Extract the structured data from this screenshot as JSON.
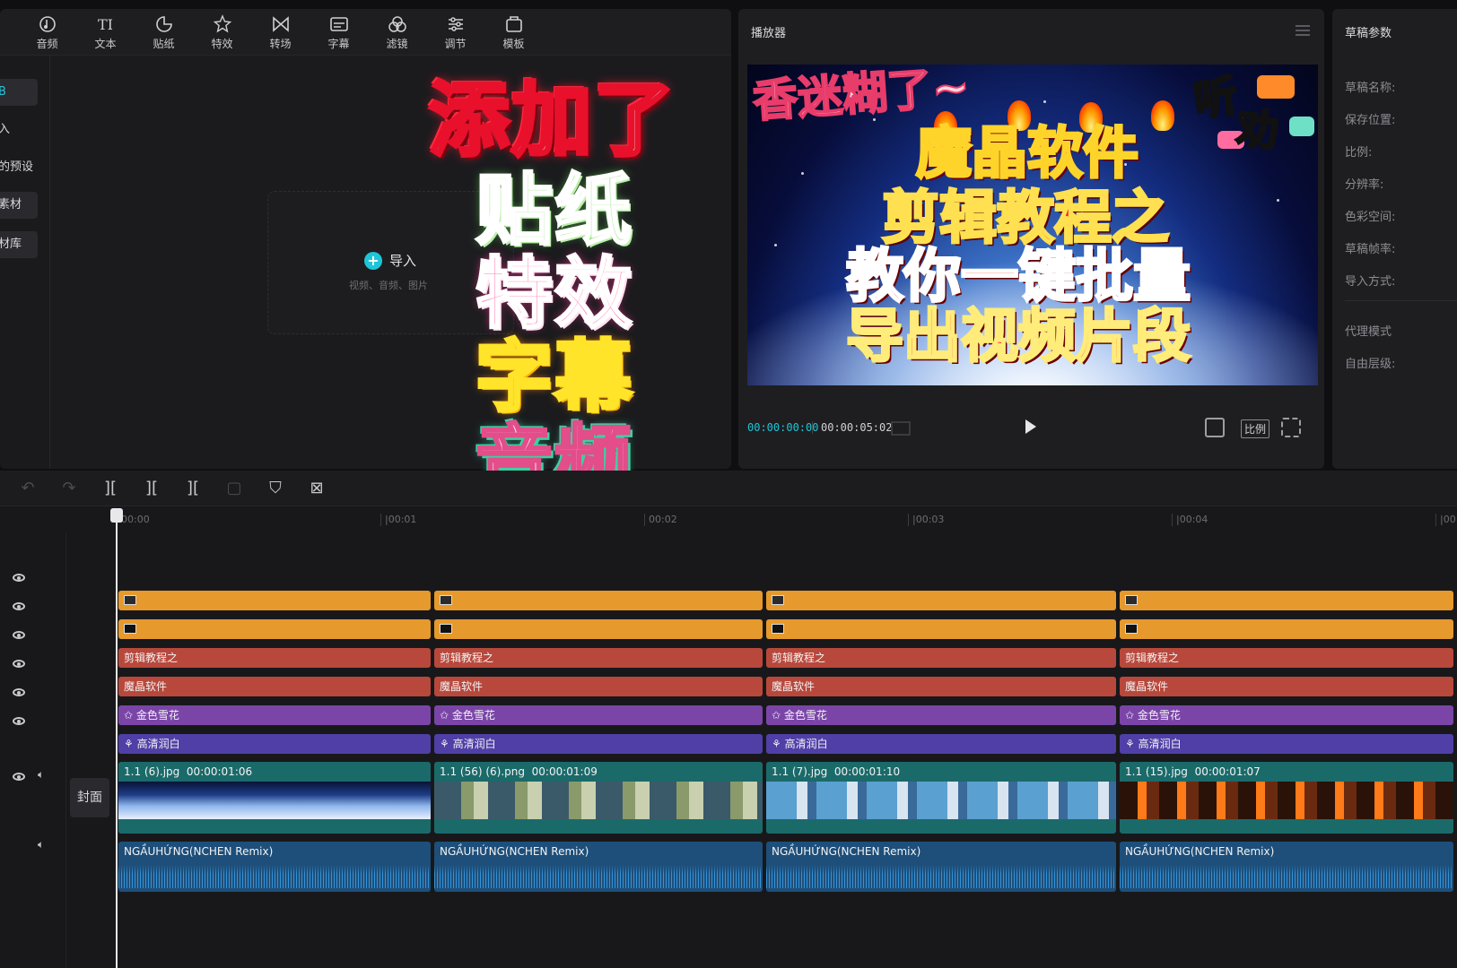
{
  "toolbar": {
    "items": [
      {
        "label": "音频",
        "icon": "music-icon"
      },
      {
        "label": "文本",
        "icon": "text-icon"
      },
      {
        "label": "贴纸",
        "icon": "sticker-icon"
      },
      {
        "label": "特效",
        "icon": "effects-icon"
      },
      {
        "label": "转场",
        "icon": "transition-icon"
      },
      {
        "label": "字幕",
        "icon": "subtitle-icon"
      },
      {
        "label": "滤镜",
        "icon": "filter-icon"
      },
      {
        "label": "调节",
        "icon": "adjust-icon"
      },
      {
        "label": "模板",
        "icon": "template-icon"
      }
    ]
  },
  "sidebar": {
    "items": [
      {
        "label": "B"
      },
      {
        "label": "入"
      },
      {
        "label": "的预设"
      },
      {
        "label": "素材"
      },
      {
        "label": "材库"
      }
    ]
  },
  "media": {
    "import_label": "导入",
    "import_hint": "视频、音频、图片"
  },
  "overlay": {
    "line1": "添加了",
    "line2": "贴纸",
    "line3": "特效",
    "line4": "字幕",
    "line5": "音频"
  },
  "player": {
    "title": "播放器",
    "screen": {
      "text0": "香迷糊了~",
      "text1": "魔晶软件",
      "text2": "剪辑教程之",
      "text3": "教你一键批量",
      "text4": "导出视频片段",
      "text5": "听",
      "text6": "劝"
    },
    "current_time": "00:00:00:00",
    "total_time": "00:00:05:02",
    "ratio_label": "比例"
  },
  "draft": {
    "title": "草稿参数",
    "fields": [
      "草稿名称:",
      "保存位置:",
      "比例:",
      "分辨率:",
      "色彩空间:",
      "草稿帧率:",
      "导入方式:"
    ],
    "fields2": [
      "代理模式",
      "自由层级:"
    ]
  },
  "timeline": {
    "ruler": [
      "00:00",
      "|00:01",
      "00:02",
      "|00:03",
      "|00:04",
      "|00:0"
    ],
    "cover_label": "封面",
    "text_clip_a": "剪辑教程之",
    "text_clip_b": "魔晶软件",
    "effect_clip": "金色雪花",
    "filter_clip": "高清润白",
    "video_clips": [
      {
        "name": "1.1 (6).jpg",
        "duration": "00:00:01:06"
      },
      {
        "name": "1.1 (56) (6).png",
        "duration": "00:00:01:09"
      },
      {
        "name": "1.1 (7).jpg",
        "duration": "00:00:01:10"
      },
      {
        "name": "1.1 (15).jpg",
        "duration": "00:00:01:07"
      }
    ],
    "audio_clip": "NGẦUHỨNG(NCHEN Remix)"
  },
  "colors": {
    "accent": "#1fc4d6",
    "sticker_track": "#e6992c",
    "text_track": "#b8483b",
    "effect_track": "#7b45a8",
    "filter_track": "#4f3fa6",
    "video_track": "#1b6a6a",
    "audio_track": "#1d4f7a"
  }
}
